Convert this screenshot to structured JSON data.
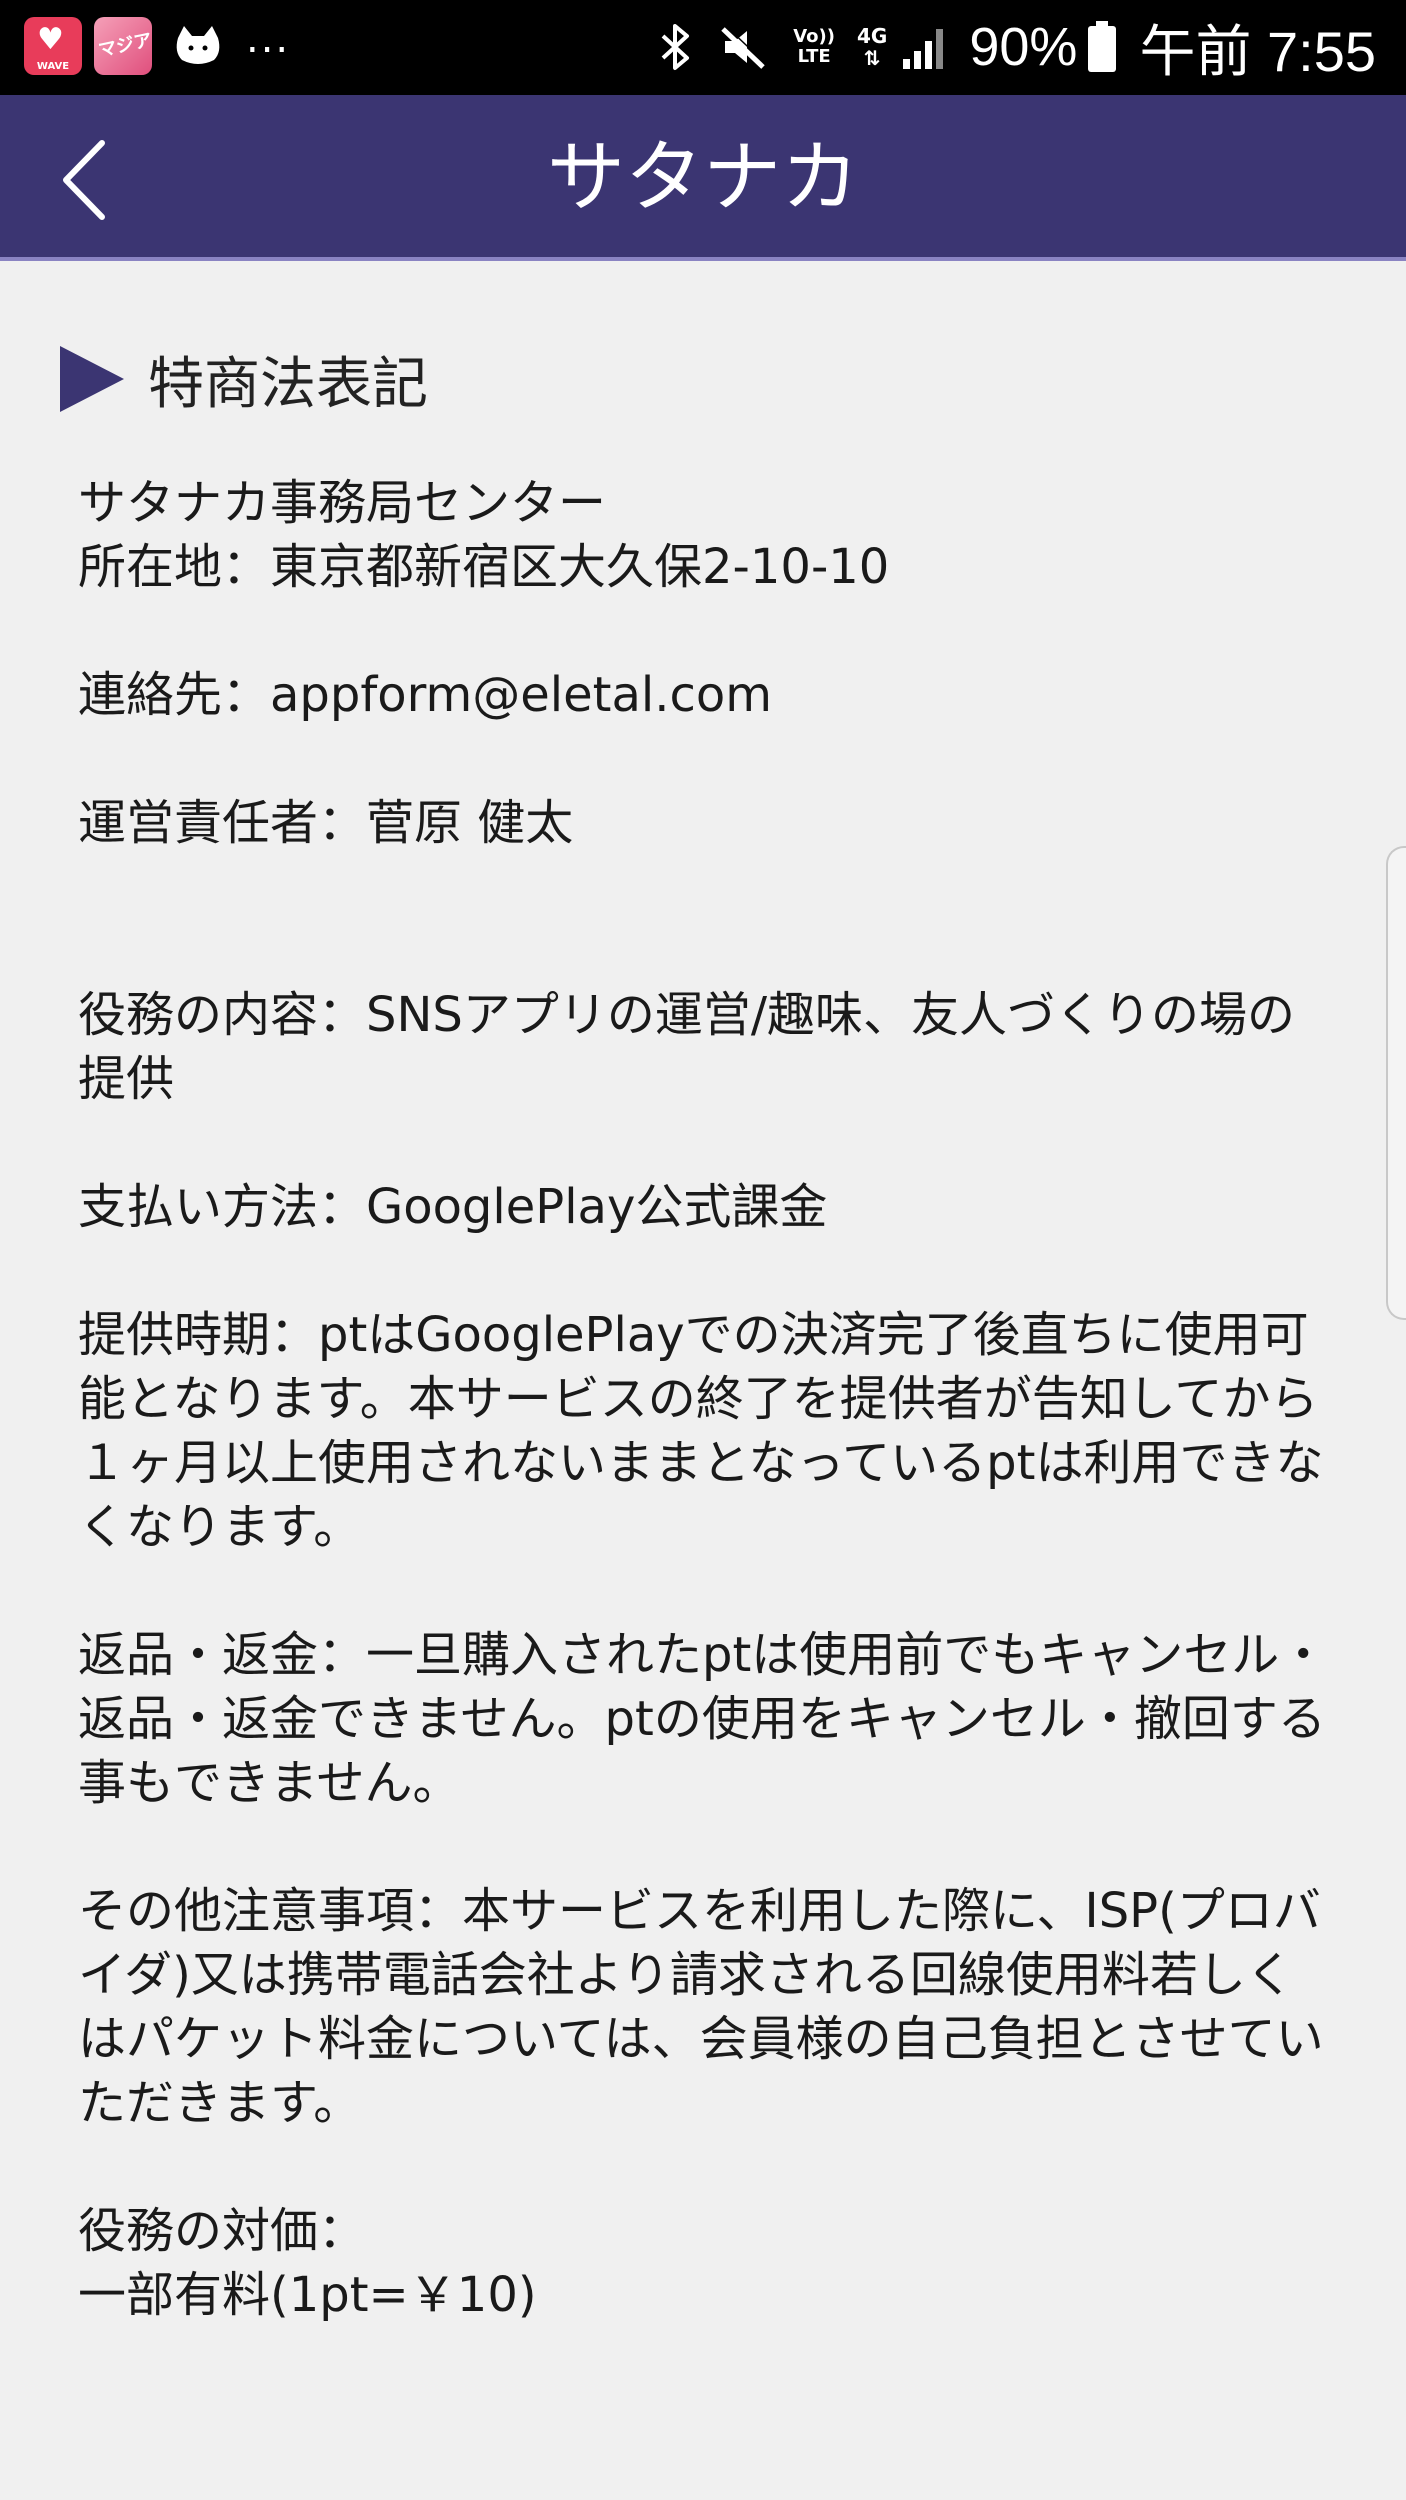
{
  "status_bar": {
    "app_icon_1_label": "WAVE",
    "app_icon_2_label": "マジア",
    "more": "...",
    "volte_top": "Vo))",
    "volte_bottom": "LTE",
    "network": "4G",
    "battery": "90%",
    "time": "午前 7:55"
  },
  "header": {
    "title": "サタナカ"
  },
  "section": {
    "title": "特商法表記"
  },
  "legal": {
    "company": "サタナカ事務局センター",
    "address": "所在地：東京都新宿区大久保2-10-10",
    "contact": "連絡先：appform@eletal.com",
    "manager": "運営責任者：菅原 健太",
    "service": "役務の内容：SNSアプリの運営/趣味、友人づくりの場の提供",
    "payment": "支払い方法：GooglePlay公式課金",
    "timing": "提供時期：ptはGooglePlayでの決済完了後直ちに使用可能となります。本サービスの終了を提供者が告知してから１ヶ月以上使用されないままとなっているptは利用できなくなります。",
    "refund": "返品・返金：一旦購入されたptは使用前でもキャンセル・返品・返金できません。ptの使用をキャンセル・撤回する事もできません。",
    "notes": "その他注意事項：本サービスを利用した際に、ISP(プロバイダ)又は携帯電話会社より請求される回線使用料若しくはパケット料金については、会員様の自己負担とさせていただきます。",
    "price_label": "役務の対価：",
    "price_value": "一部有料(1pt=￥10)"
  },
  "colors": {
    "header_bg": "#3b3572",
    "accent": "#3b3572",
    "background": "#f0f0f0"
  }
}
